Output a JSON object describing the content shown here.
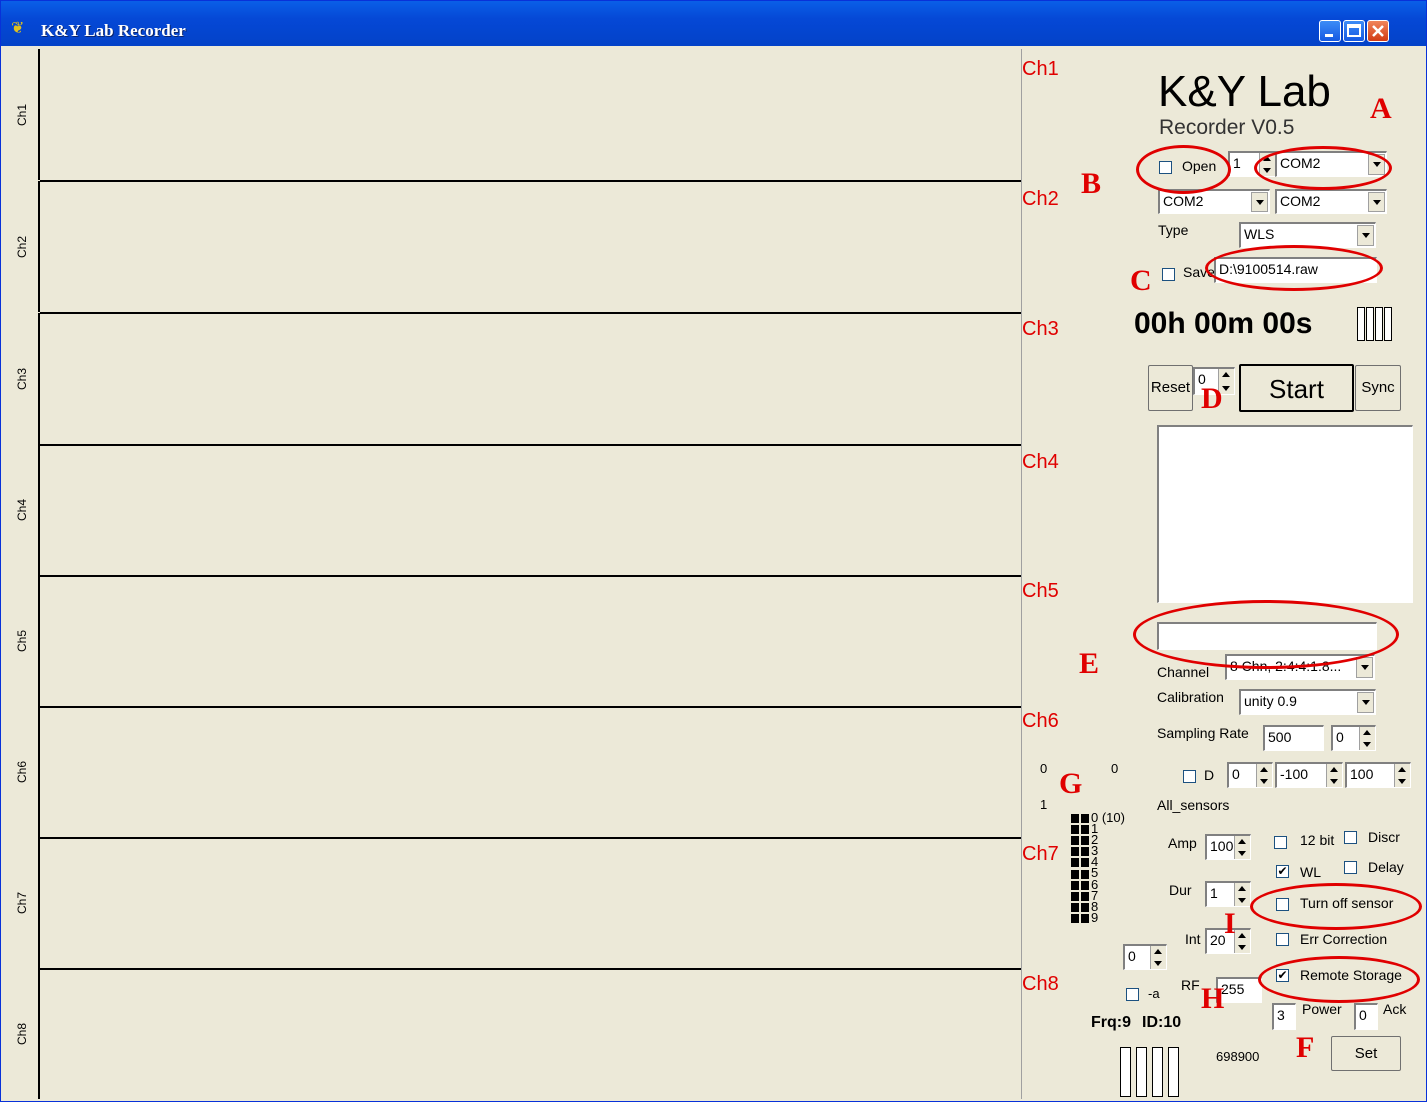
{
  "window": {
    "title": "K&Y Lab  Recorder"
  },
  "lanes": [
    "Ch1",
    "Ch2",
    "Ch3",
    "Ch4",
    "Ch5",
    "Ch6",
    "Ch7",
    "Ch8"
  ],
  "brand": {
    "name": "K&Y Lab",
    "version": "Recorder V0.5"
  },
  "ports": {
    "open_label": "Open",
    "port_index": "1",
    "com_a": "COM2",
    "com_b": "COM2",
    "com_c": "COM2"
  },
  "type": {
    "label": "Type",
    "value": "WLS"
  },
  "save": {
    "label": "Save",
    "path": "D:\\9100514.raw"
  },
  "timer": {
    "text": "00h 00m 00s"
  },
  "controls": {
    "reset_label": "Reset",
    "reset_count": "0",
    "start_label": "Start",
    "sync_label": "Sync"
  },
  "log": {
    "text": "",
    "input_value": ""
  },
  "channel": {
    "label": "Channel",
    "value": "8 Chn, 2:4:4:1:8..."
  },
  "calibration": {
    "label": "Calibration",
    "value": "unity 0.9"
  },
  "sampling": {
    "label": "Sampling Rate",
    "value": "500",
    "offset": "0"
  },
  "display": {
    "d_label": "D",
    "d_value": "0",
    "min": "-100",
    "max": "100",
    "left_top": "0",
    "left_mid": "0",
    "left_bottom": "1"
  },
  "sensors": {
    "title": "All_sensors",
    "rows": [
      "0 (10)",
      "1",
      "2",
      "3",
      "4",
      "5",
      "6",
      "7",
      "8",
      "9"
    ],
    "selector": "0",
    "a_label": "-a",
    "frq": "Frq:9",
    "id": "ID:10",
    "counter": "698900"
  },
  "params": {
    "amp_label": "Amp",
    "amp_value": "100",
    "dur_label": "Dur",
    "dur_value": "1",
    "int_label": "Int",
    "int_value": "20",
    "rf_label": "RF",
    "rf_value": "255",
    "power_label": "Power",
    "power_value": "3",
    "ack_label": "Ack",
    "ack_value": "0",
    "set_label": "Set"
  },
  "options": {
    "bit12": "12 bit",
    "discr": "Discr",
    "wl": "WL",
    "delay": "Delay",
    "turn_off": "Turn off sensor",
    "err_corr": "Err Correction",
    "remote": "Remote Storage"
  },
  "annotations": [
    "A",
    "B",
    "C",
    "D",
    "E",
    "F",
    "G",
    "H",
    "I"
  ],
  "colors": {
    "annotation": "#e00000",
    "titlebar": "#0548d6",
    "face": "#ece9d8"
  }
}
